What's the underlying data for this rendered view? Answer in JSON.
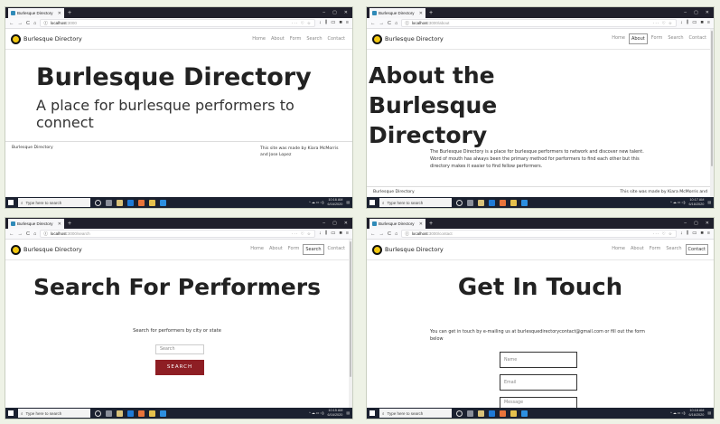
{
  "tab_title": "Burlesque Directory",
  "brand": "Burlesque Directory",
  "nav": [
    "Home",
    "About",
    "Form",
    "Search",
    "Contact"
  ],
  "window_controls": [
    "–",
    "▢",
    "✕"
  ],
  "urls": {
    "home": {
      "host": "localhost",
      "path": ":3000"
    },
    "about": {
      "host": "localhost",
      "path": ":3000/about"
    },
    "search": {
      "host": "localhost",
      "path": ":3000/search"
    },
    "contact": {
      "host": "localhost",
      "path": ":3000/contact"
    }
  },
  "home": {
    "title": "Burlesque Directory",
    "subtitle": "A place for burlesque performers to connect",
    "footer_left": "Burlesque Directory",
    "footer_right": "This site was made by Kiara McMorris and Jose Lopez"
  },
  "about": {
    "title": "About the Burlesque Directory",
    "body": "The Burlesque Directory is a place for burlesque performers to network and discover new talent. Word of mouth has always been the primary method for performers to find each other but this directory makes it easier to find fellow performers.",
    "footer_left": "Burlesque Directory",
    "footer_right": "This site was made by Kiara McMorris and"
  },
  "search": {
    "title": "Search For Performers",
    "prompt": "Search for performers by city or state",
    "input_placeholder": "Search",
    "button": "SEARCH"
  },
  "contact": {
    "title": "Get In Touch",
    "body": "You can get in touch by e-mailing us at burlesquedirectorycontact@gmail.com or fill out the form below",
    "name_placeholder": "Name",
    "email_placeholder": "Email",
    "message_placeholder": "Message"
  },
  "taskbar": {
    "search_placeholder": "Type here to search",
    "times": [
      "10:16 AM",
      "10:17 AM",
      "10:15 AM",
      "10:18 AM"
    ],
    "date": "6/16/2020"
  },
  "colors": {
    "search_button": "#8e1e24",
    "logo_yellow": "#f2c811",
    "taskbar": "#1b2130",
    "tabbar": "#1f1f2b"
  }
}
